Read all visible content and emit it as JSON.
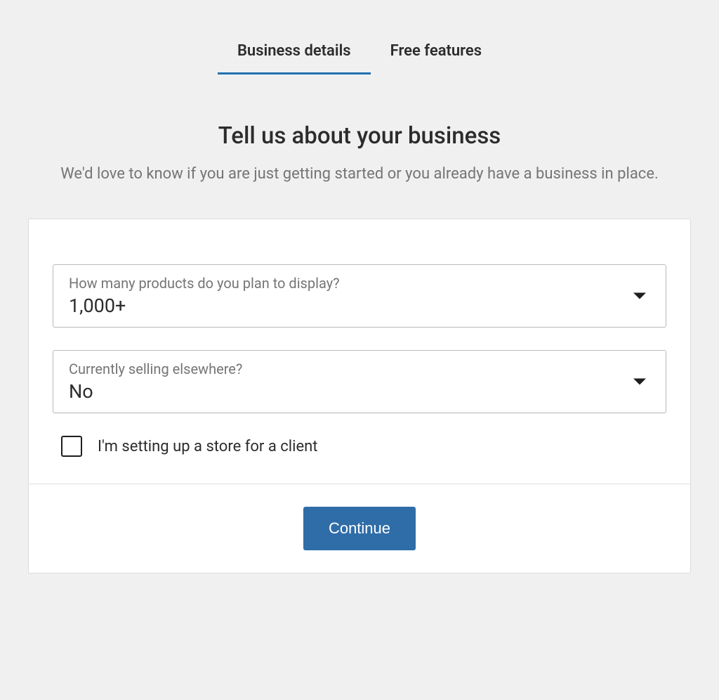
{
  "tabs": {
    "business_details": "Business details",
    "free_features": "Free features"
  },
  "header": {
    "title": "Tell us about your business",
    "subtitle": "We'd love to know if you are just getting started or you already have a business in place."
  },
  "form": {
    "product_count": {
      "label": "How many products do you plan to display?",
      "value": "1,000+"
    },
    "selling_elsewhere": {
      "label": "Currently selling elsewhere?",
      "value": "No"
    },
    "client_checkbox": {
      "label": "I'm setting up a store for a client",
      "checked": false
    }
  },
  "footer": {
    "continue_label": "Continue"
  }
}
